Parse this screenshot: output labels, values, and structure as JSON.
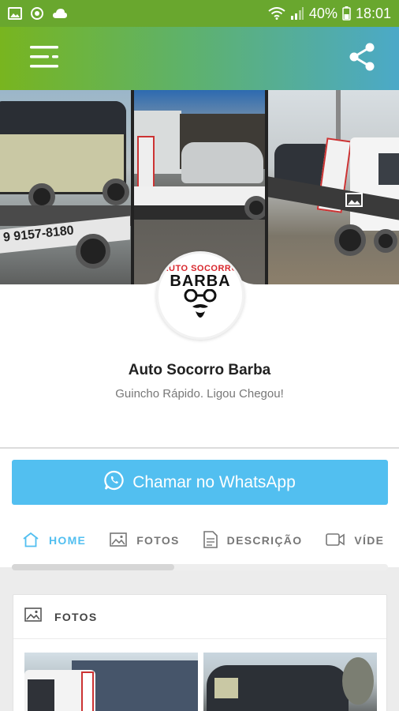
{
  "status_bar": {
    "battery": "40%",
    "time": "18:01",
    "icons": [
      "image-icon",
      "sync-icon",
      "cloud-icon",
      "wifi-icon",
      "signal-icon",
      "battery-icon"
    ]
  },
  "app_bar": {
    "menu_icon": "menu-icon",
    "share_icon": "share-icon",
    "gradient": [
      "#78b51f",
      "#5fb268",
      "#4ba9c8"
    ]
  },
  "cover": {
    "photos": [
      "truck-with-van",
      "truck-with-white-car",
      "truck-with-dark-car"
    ],
    "logo": {
      "arc_text": "AUTO SOCORRO",
      "main_text": "BARBA"
    }
  },
  "profile": {
    "name": "Auto Socorro Barba",
    "tagline": "Guincho Rápido. Ligou Chegou!"
  },
  "whatsapp_button": {
    "label": "Chamar no WhatsApp",
    "color": "#52bff0"
  },
  "tabs": [
    {
      "label": "HOME",
      "icon": "home-icon",
      "active": true
    },
    {
      "label": "FOTOS",
      "icon": "image-icon",
      "active": false
    },
    {
      "label": "DESCRIÇÃO",
      "icon": "document-icon",
      "active": false
    },
    {
      "label": "VÍDE",
      "icon": "video-icon",
      "active": false
    }
  ],
  "photos_card": {
    "title": "FOTOS",
    "icon": "image-icon"
  },
  "colors": {
    "accent": "#52bff0",
    "status_bar": "#69a72e"
  }
}
